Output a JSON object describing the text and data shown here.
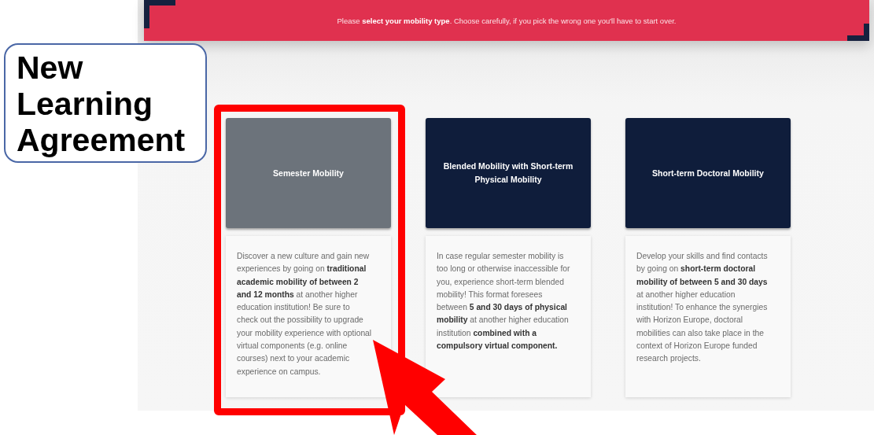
{
  "banner": {
    "text": "Please **select your mobility type**. Choose carefully, if you pick the wrong one you'll have to start over."
  },
  "callout": {
    "text": "New Learning Agreement"
  },
  "mobility_types": [
    {
      "title": "Semester Mobility",
      "selected": true,
      "description": "Discover a new culture and gain new experiences by going on **traditional academic mobility of between 2 and 12 months** at another higher education institution! Be sure to check out the possibility to upgrade your mobility experience with optional virtual components (e.g. online courses) next to your academic experience on campus."
    },
    {
      "title": "Blended Mobility with Short-term Physical Mobility",
      "selected": false,
      "description": "In case regular semester mobility is too long or otherwise inaccessible for you, experience short-term blended mobility! This format foresees between **5 and 30 days of physical mobility** at another higher education institution **combined with a compulsory virtual component.**"
    },
    {
      "title": "Short-term Doctoral Mobility",
      "selected": false,
      "description": "Develop your skills and find contacts by going on **short-term doctoral mobility of between 5 and 30 days** at another higher education institution! To enhance the synergies with Horizon Europe, doctoral mobilities can also take place in the context of Horizon Europe funded research projects."
    }
  ]
}
